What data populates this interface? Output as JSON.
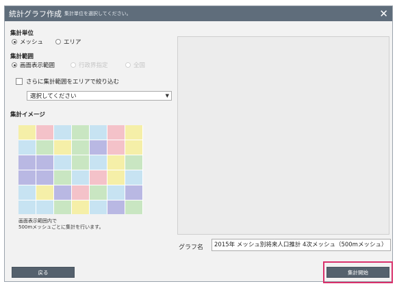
{
  "titlebar": {
    "title": "統計グラフ作成",
    "subtitle": "集計単位を選択してください。",
    "close_glyph": "✕"
  },
  "aggregation_unit": {
    "label": "集計単位",
    "options": [
      {
        "label": "メッシュ",
        "selected": true
      },
      {
        "label": "エリア",
        "selected": false
      }
    ]
  },
  "aggregation_range": {
    "label": "集計範囲",
    "options": [
      {
        "label": "画面表示範囲",
        "selected": true,
        "enabled": true
      },
      {
        "label": "行政界指定",
        "selected": false,
        "enabled": false
      },
      {
        "label": "全国",
        "selected": false,
        "enabled": false
      }
    ]
  },
  "narrow_area": {
    "checkbox_label": "さらに集計範囲をエリアで絞り込む",
    "checked": false,
    "select_value": "選択してください"
  },
  "aggregation_image": {
    "label": "集計イメージ",
    "description_line1": "画面表示範囲内で",
    "description_line2": "500mメッシュごとに集計を行います。"
  },
  "graph_name": {
    "label": "グラフ名",
    "value": "2015年 メッシュ別将来人口推計 4次メッシュ（500mメッシュ）"
  },
  "buttons": {
    "back_label": "戻る",
    "start_label": "集計開始"
  },
  "colors": {
    "titlebar": "#5f6d7b",
    "button": "#55616d",
    "highlight": "#d9306b"
  }
}
